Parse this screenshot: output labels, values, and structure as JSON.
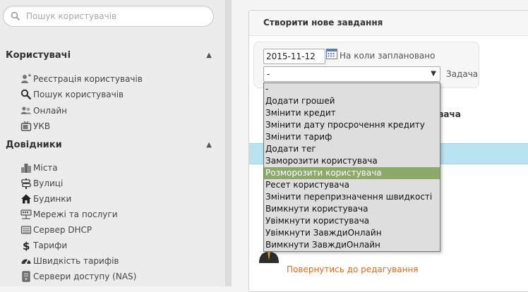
{
  "search": {
    "placeholder": "Пошук користувачів"
  },
  "sidebar": {
    "sections": [
      {
        "title": "Користувачі",
        "items": [
          {
            "label": "Реєстрація користувачів",
            "icon": "user-add-icon"
          },
          {
            "label": "Пошук користувачів",
            "icon": "magnifier-icon"
          },
          {
            "label": "Онлайн",
            "icon": "users-online-icon"
          },
          {
            "label": "УКВ",
            "icon": "tv-icon"
          }
        ]
      },
      {
        "title": "Довідники",
        "items": [
          {
            "label": "Міста",
            "icon": "city-icon"
          },
          {
            "label": "Вулиці",
            "icon": "street-sign-icon"
          },
          {
            "label": "Будинки",
            "icon": "house-icon"
          },
          {
            "label": "Мережі та послуги",
            "icon": "network-icon"
          },
          {
            "label": "Сервер DHCP",
            "icon": "server-icon"
          },
          {
            "label": "Тарифи",
            "icon": "dollar-icon"
          },
          {
            "label": "Швидкість тарифів",
            "icon": "speedometer-icon"
          },
          {
            "label": "Сервери доступу (NAS)",
            "icon": "nas-server-icon"
          }
        ]
      }
    ]
  },
  "panel": {
    "title": "Створити нове завдання",
    "date_value": "2015-11-12",
    "date_label": "На коли заплановано",
    "task_selected": "-",
    "task_label": "Задача",
    "second_header": "увача",
    "back_link": "Повернутись до редагування"
  },
  "dropdown": {
    "selected_index": 7,
    "options": [
      "-",
      "Додати грошей",
      "Змінити кредит",
      "Змінити дату просрочення кредиту",
      "Змінити тариф",
      "Додати тег",
      "Заморозити користувача",
      "Розморозити користувача",
      "Ресет користувача",
      "Змінити переприз­начення швидкості",
      "Вимкнути користувача",
      "Увімкнути користувача",
      "Увімкнути ЗавждиОнлайн",
      "Вимкнути ЗавждиОнлайн"
    ]
  },
  "colors": {
    "selected_option": "#8ba969",
    "link": "#e06b1e",
    "band": "#b9e3f0"
  }
}
